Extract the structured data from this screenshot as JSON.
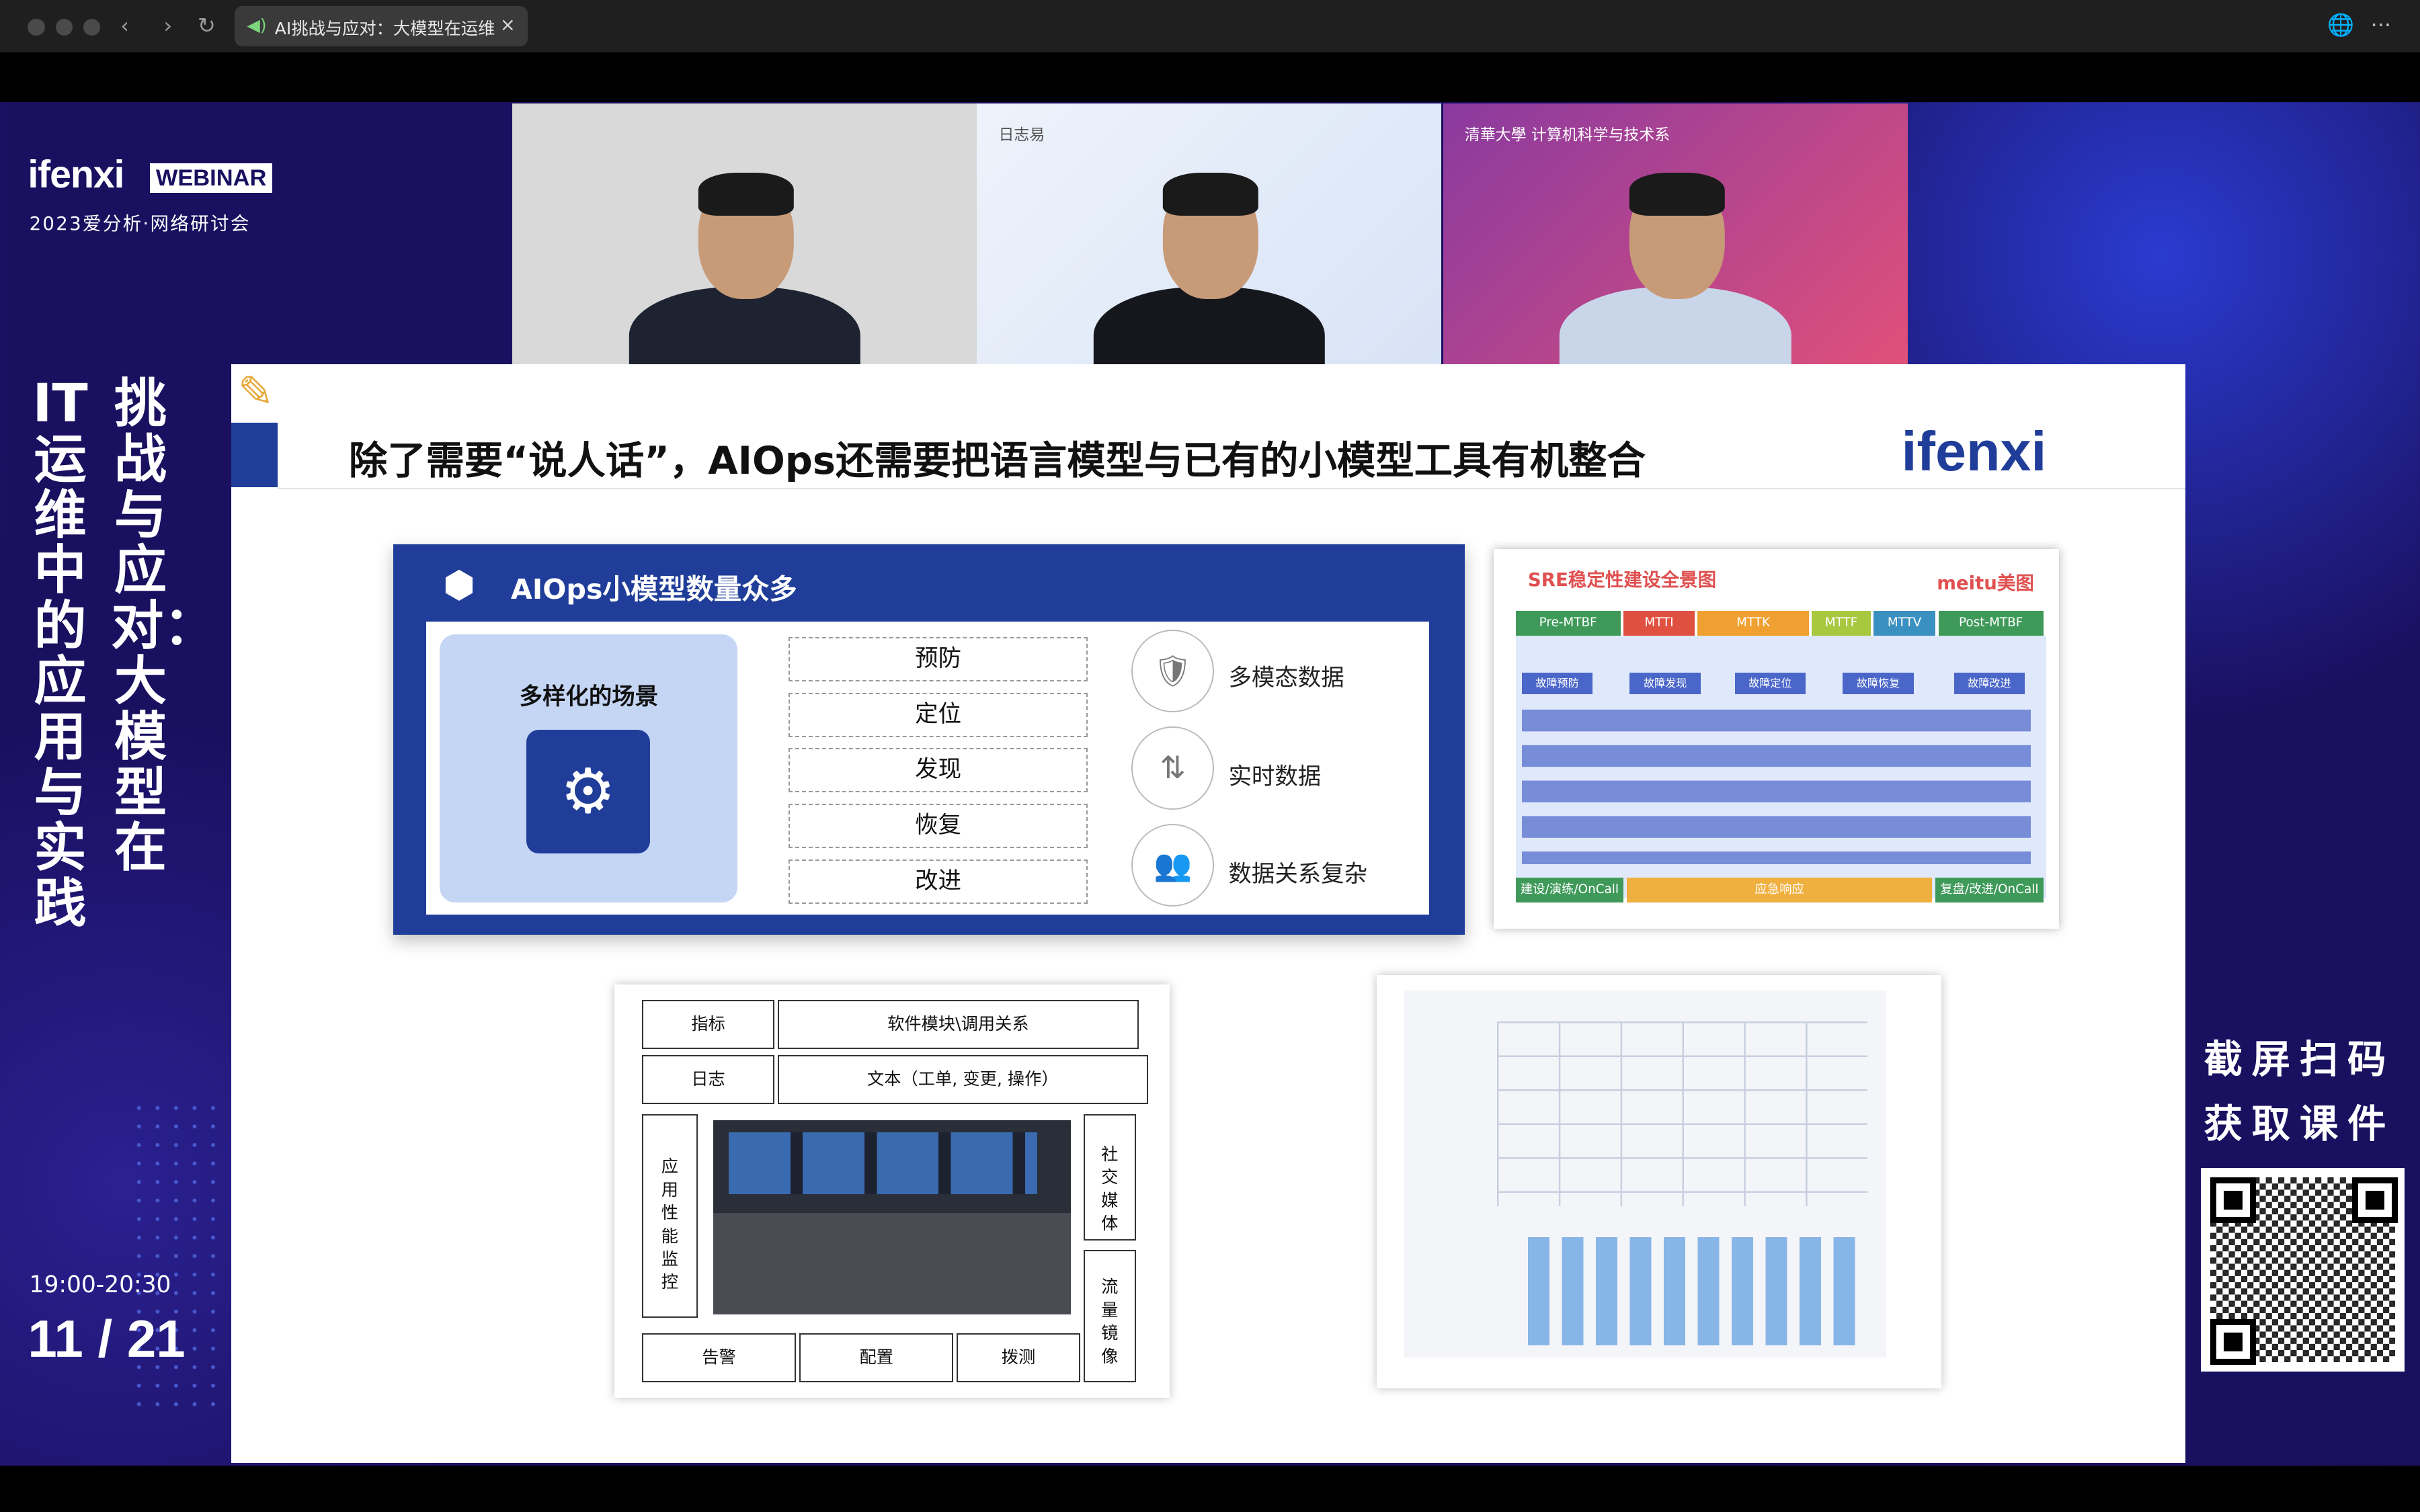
{
  "browser": {
    "tab_title": "AI挑战与应对：大模型在运维",
    "nav": {
      "back": "‹",
      "forward": "›",
      "reload": "↻",
      "close_tab": "×"
    },
    "toolbar": {
      "globe": "🌐",
      "more": "···"
    }
  },
  "sidebar": {
    "logo": "ifenxi",
    "webinar": "WEBINAR",
    "subtitle": "2023爱分析·网络研讨会",
    "vertical_title_left": "IT运维中的应用与实践",
    "vertical_title_right": "挑战与应对：大模型在",
    "time": "19:00-20:30",
    "date": "11 / 21"
  },
  "videos": [
    {
      "label": ""
    },
    {
      "label": "日志易"
    },
    {
      "label": "清華大學 计算机科学与技术系"
    }
  ],
  "slide": {
    "title": "除了需要“说人话”，AIOps还需要把语言模型与已有的小模型工具有机整合",
    "brand": "ifenxi",
    "panel": {
      "title": "AIOps小模型数量众多",
      "scene_label": "多样化的场景",
      "categories": [
        "预防",
        "定位",
        "发现",
        "恢复",
        "改进"
      ],
      "data_types": [
        "多模态数据",
        "实时数据",
        "数据关系复杂"
      ]
    },
    "sre": {
      "title": "SRE稳定性建设全景图",
      "brand": "meitu美图",
      "phases": [
        "Pre-MTBF",
        "MTTI",
        "MTTK",
        "MTTF",
        "MTTV",
        "Post-MTBF"
      ],
      "stages": [
        "故障预防",
        "故障发现",
        "故障定位",
        "故障恢复",
        "故障改进"
      ],
      "bottom": [
        "建设/演练/OnCall",
        "应急响应",
        "复盘/改进/OnCall"
      ]
    },
    "grid": {
      "metric": "指标",
      "software": "软件模块\\调用关系",
      "log": "日志",
      "text": "文本（工单, 变更, 操作）",
      "apm": "应用性能监控",
      "social": "社交媒体",
      "traffic": "流量镜像",
      "alert": "告警",
      "config": "配置",
      "probe": "拨测"
    }
  },
  "qr": {
    "label": "截屏扫码获取课件"
  }
}
